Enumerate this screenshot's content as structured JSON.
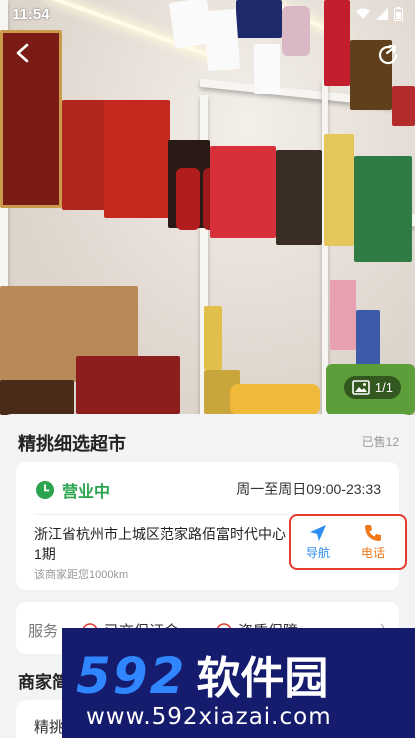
{
  "status_bar": {
    "time": "11:54"
  },
  "hero": {
    "photo_counter": "1/1"
  },
  "shop": {
    "name": "精挑细选超市",
    "sold": "已售12",
    "open_status": "营业中",
    "hours": "周一至周日09:00-23:33",
    "address": "浙江省杭州市上城区范家路佰富时代中心 1期",
    "distance": "该商家距您1000km"
  },
  "actions": {
    "navigate_label": "导航",
    "call_label": "电话"
  },
  "service": {
    "label": "服务",
    "items": [
      "已交保证金",
      "资质保障"
    ]
  },
  "section": {
    "title": "商家简介",
    "card_label": "精挑"
  },
  "watermark": {
    "logo_number": "592",
    "logo_text": "软件园",
    "url": "www.592xiazai.com"
  },
  "colors": {
    "open_green": "#2aa44f",
    "nav_blue": "#2d8cf0",
    "call_orange": "#f07a1c",
    "highlight_red": "#e43a2f",
    "watermark_bg": "#151c6e"
  }
}
